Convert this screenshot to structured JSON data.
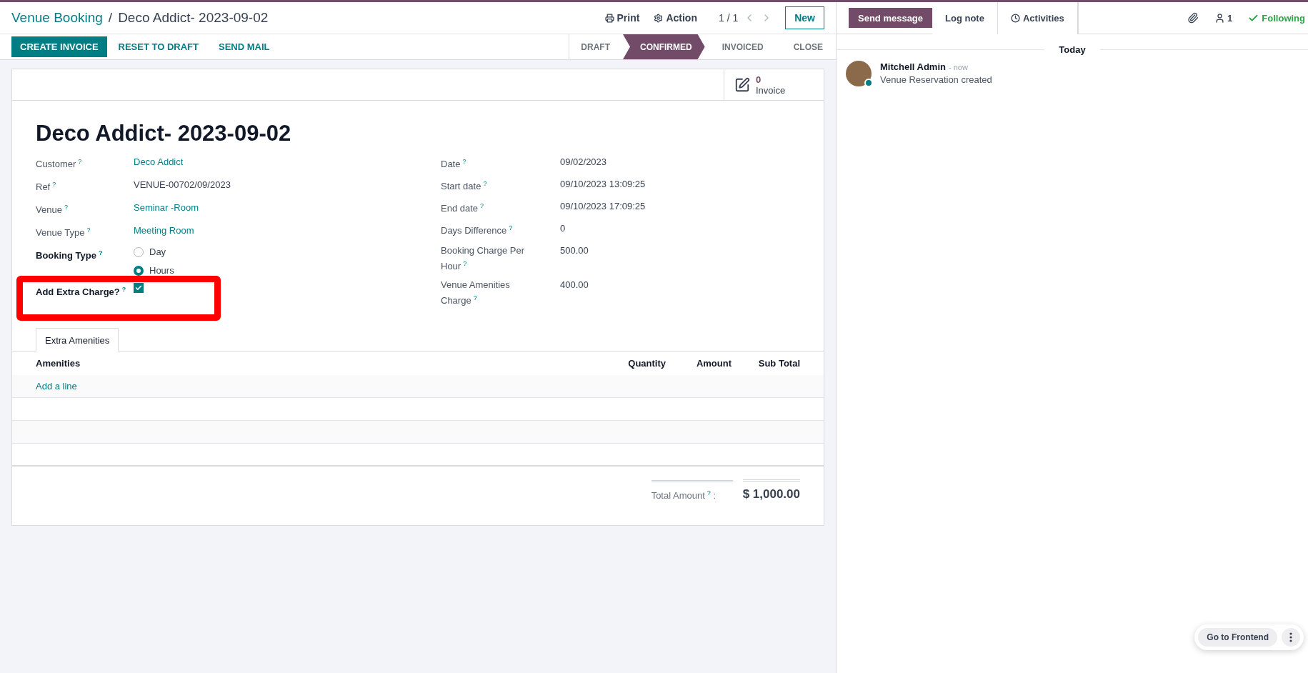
{
  "breadcrumb": {
    "parent": "Venue Booking",
    "separator": "/",
    "current": "Deco Addict- 2023-09-02"
  },
  "control_panel": {
    "print": "Print",
    "action": "Action",
    "pager": "1 / 1",
    "new_button": "New"
  },
  "action_buttons": [
    {
      "label": "CREATE INVOICE",
      "kind": "primary"
    },
    {
      "label": "RESET TO DRAFT",
      "kind": "link"
    },
    {
      "label": "SEND MAIL",
      "kind": "link"
    }
  ],
  "status_bar": [
    {
      "label": "DRAFT",
      "selected": false
    },
    {
      "label": "CONFIRMED",
      "selected": true
    },
    {
      "label": "INVOICED",
      "selected": false
    },
    {
      "label": "CLOSE",
      "selected": false
    }
  ],
  "smart_button": {
    "count": "0",
    "label": "Invoice"
  },
  "title": "Deco Addict- 2023-09-02",
  "left_fields": [
    {
      "label": "Customer",
      "help": "?",
      "value": "Deco Addict",
      "kind": "link"
    },
    {
      "label": "Ref",
      "help": "?",
      "value": "VENUE-00702/09/2023",
      "kind": "text"
    },
    {
      "label": "Venue",
      "help": "?",
      "value": "Seminar -Room",
      "kind": "link"
    },
    {
      "label": "Venue Type",
      "help": "?",
      "value": "Meeting Room",
      "kind": "link"
    }
  ],
  "booking_type": {
    "label": "Booking Type",
    "help": "?",
    "options": [
      {
        "label": "Day",
        "selected": false
      },
      {
        "label": "Hours",
        "selected": true
      }
    ]
  },
  "extra_charge": {
    "label": "Add Extra Charge?",
    "help": "?",
    "checked": true,
    "highlighted": true
  },
  "right_fields": [
    {
      "label": "Date",
      "help": "?",
      "value": "09/02/2023"
    },
    {
      "label": "Start date",
      "help": "?",
      "value": "09/10/2023 13:09:25"
    },
    {
      "label": "End date",
      "help": "?",
      "value": "09/10/2023 17:09:25"
    },
    {
      "label": "Days Difference",
      "help": "?",
      "value": "0"
    },
    {
      "label": "Booking Charge Per Hour",
      "help": "?",
      "value": "500.00"
    },
    {
      "label": "Venue Amenities Charge",
      "help": "?",
      "value": "400.00"
    }
  ],
  "tabs": [
    {
      "label": "Extra Amenities",
      "selected": true
    }
  ],
  "table": {
    "columns": [
      "Amenities",
      "Quantity",
      "Amount",
      "Sub Total"
    ],
    "add_line": "Add a line"
  },
  "total": {
    "label": "Total Amount",
    "help": "?",
    "suffix": ":",
    "value": "$ 1,000.00"
  },
  "chatter": {
    "buttons": [
      {
        "label": "Send message",
        "selected": true
      },
      {
        "label": "Log note",
        "selected": false
      },
      {
        "label": "Activities",
        "selected": false
      }
    ],
    "followers": "1",
    "following": "Following",
    "date_separator": "Today",
    "messages": [
      {
        "author": "Mitchell Admin",
        "time": "- now",
        "body": "Venue Reservation created"
      }
    ]
  },
  "floating": {
    "label": "Go to Frontend"
  }
}
